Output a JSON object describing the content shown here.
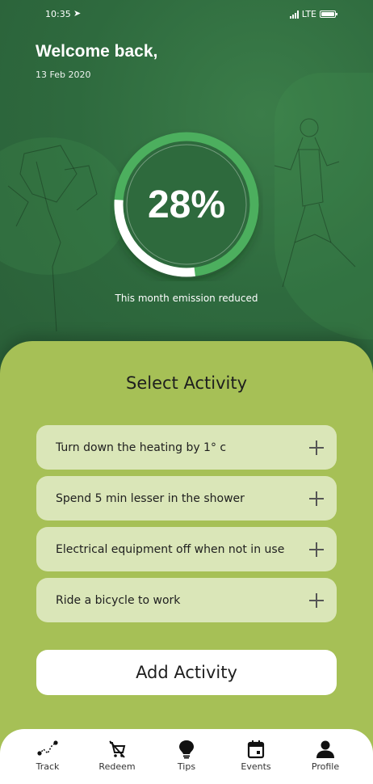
{
  "status": {
    "time": "10:35",
    "network": "LTE"
  },
  "header": {
    "welcome": "Welcome back,",
    "date": "13 Feb 2020"
  },
  "progress": {
    "value_text": "28%",
    "fraction": 0.28,
    "caption": "This month emission reduced"
  },
  "panel": {
    "title": "Select Activity",
    "activities": [
      {
        "label": "Turn down the heating by 1° c"
      },
      {
        "label": "Spend 5 min lesser in the shower"
      },
      {
        "label": "Electrical equipment off when not in use"
      },
      {
        "label": "Ride a bicycle to work"
      }
    ],
    "add_button": "Add Activity"
  },
  "tabbar": {
    "items": [
      {
        "label": "Track",
        "icon": "route-icon"
      },
      {
        "label": "Redeem",
        "icon": "cart-off-icon",
        "active": true
      },
      {
        "label": "Tips",
        "icon": "lightbulb-icon"
      },
      {
        "label": "Events",
        "icon": "calendar-icon"
      },
      {
        "label": "Profile",
        "icon": "user-icon"
      }
    ]
  },
  "colors": {
    "dark_green": "#2f6b3f",
    "ring_green": "#4caf5e",
    "panel_green": "#a6c056",
    "card": "#dae6b8"
  }
}
